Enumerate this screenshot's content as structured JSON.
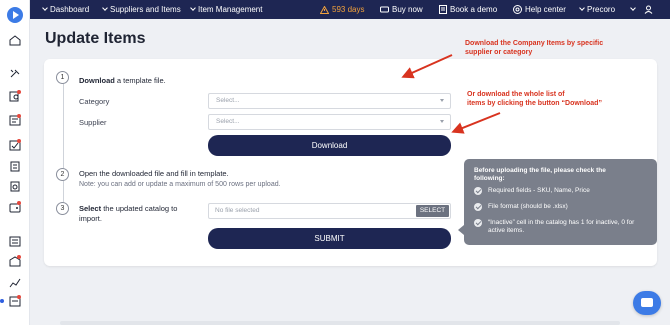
{
  "topbar": {
    "nav": [
      "Dashboard",
      "Suppliers and Items",
      "Item Management"
    ],
    "trial_days": "593 days",
    "buy_now": "Buy now",
    "book_demo": "Book a demo",
    "help_center": "Help center",
    "company": "Precoro"
  },
  "page": {
    "title": "Update Items"
  },
  "steps": {
    "one": {
      "number": "1",
      "text_bold": "Download",
      "text_rest": " a template file.",
      "category_label": "Category",
      "category_placeholder": "Select...",
      "supplier_label": "Supplier",
      "supplier_placeholder": "Select...",
      "download_label": "Download"
    },
    "two": {
      "number": "2",
      "text": "Open the downloaded file and fill in template.",
      "note": "Note: you can add or update a maximum of 500 rows per upload."
    },
    "three": {
      "number": "3",
      "text_bold": "Select",
      "text_rest_line1": " the updated catalog to",
      "text_line2": "import.",
      "file_placeholder": "No file selected",
      "select_label": "SELECT",
      "submit_label": "SUBMIT"
    }
  },
  "annotations": {
    "a1_line1": "Download the Company Items by specific",
    "a1_line2": "supplier or category",
    "a2_line1": "Or download the whole list of",
    "a2_line2": "items by clicking the button “Download”"
  },
  "tooltip": {
    "title_line1": "Before uploading the file, please check the",
    "title_line2": "following:",
    "rows": [
      "Required fields - SKU, Name, Price",
      "File format (should be .xlsx)",
      "“Inactive” cell in the catalog has 1 for inactive, 0 for active items."
    ]
  },
  "colors": {
    "navy": "#1e2653",
    "accent_red": "#d8331f",
    "warning": "#f2a13b",
    "brand_blue": "#3c7be6"
  }
}
